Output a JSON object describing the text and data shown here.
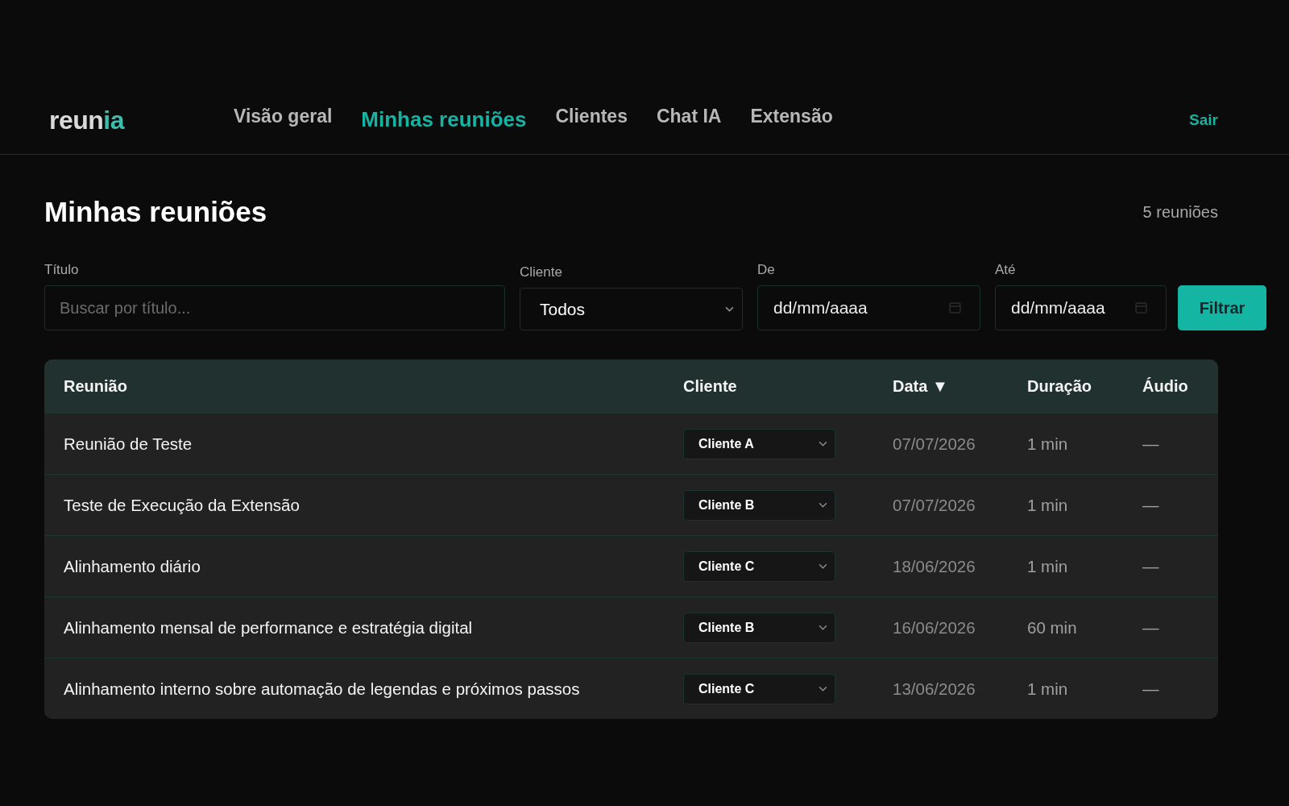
{
  "header": {
    "logo_parts": [
      "reun",
      "ia"
    ],
    "nav": [
      {
        "label": "Visão geral",
        "selected": false
      },
      {
        "label": "Minhas reuniões",
        "selected": true
      },
      {
        "label": "Clientes",
        "selected": false
      },
      {
        "label": "Chat IA",
        "selected": false
      },
      {
        "label": "Extensão",
        "selected": false
      }
    ],
    "logout": "Sair"
  },
  "page": {
    "title": "Minhas reuniões",
    "count": "5 reuniões"
  },
  "filters": [
    {
      "kind": "text",
      "label": "Título",
      "placeholder": "Buscar por título..."
    },
    {
      "kind": "select",
      "label": "Cliente",
      "value": "Todos"
    },
    {
      "kind": "date",
      "label": "De",
      "placeholder": "dd/mm/aaaa"
    },
    {
      "kind": "date",
      "label": "Até",
      "placeholder": "dd/mm/aaaa"
    }
  ],
  "filter_button": "Filtrar",
  "table": {
    "columns": [
      "Reunião",
      "Cliente",
      "Data ▼",
      "Duração",
      "Áudio"
    ],
    "rows": [
      {
        "title": "Reunião de Teste",
        "client": "Cliente A",
        "date": "07/07/2026",
        "duration": "1 min",
        "audio": "—"
      },
      {
        "title": "Teste de Execução da Extensão",
        "client": "Cliente B",
        "date": "07/07/2026",
        "duration": "1 min",
        "audio": "—"
      },
      {
        "title": "Alinhamento diário",
        "client": "Cliente C",
        "date": "18/06/2026",
        "duration": "1 min",
        "audio": "—"
      },
      {
        "title": "Alinhamento mensal de performance e estratégia digital",
        "client": "Cliente B",
        "date": "16/06/2026",
        "duration": "60 min",
        "audio": "—"
      },
      {
        "title": "Alinhamento interno sobre automação de legendas e próximos passos",
        "client": "Cliente C",
        "date": "13/06/2026",
        "duration": "1 min",
        "audio": "—"
      }
    ]
  }
}
